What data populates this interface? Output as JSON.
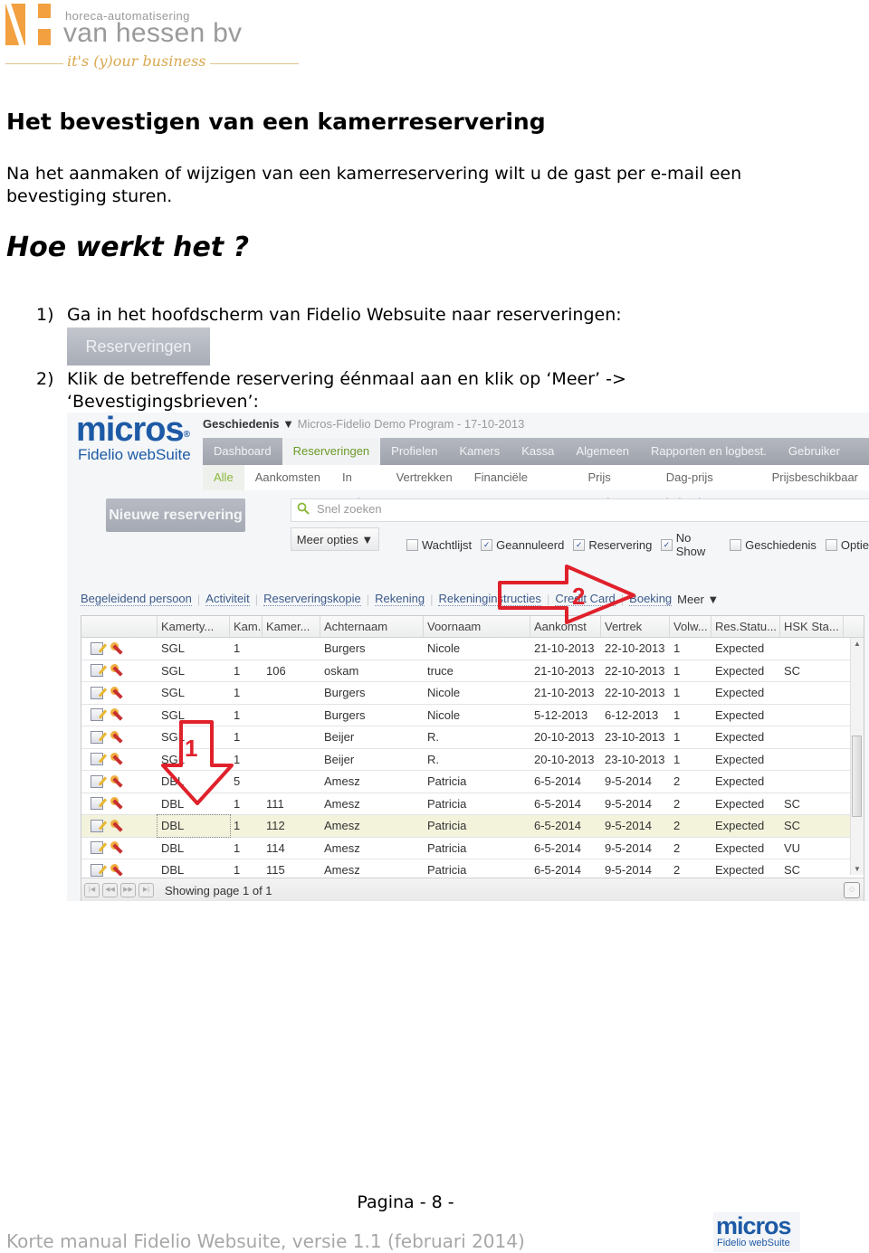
{
  "logo": {
    "tagline": "horeca-automatisering",
    "company": "van hessen bv",
    "slogan": "it's (y)our business"
  },
  "title": "Het bevestigen van een kamerreservering",
  "intro": "Na het aanmaken of wijzigen van een kamerreservering wilt u de gast per e-mail een bevestiging sturen.",
  "howto": "Hoe werkt het ?",
  "steps": [
    {
      "num": "1)",
      "text": "Ga in het hoofdscherm van Fidelio Websuite naar reserveringen:"
    },
    {
      "num": "2)",
      "text": "Klik de betreffende reservering éénmaal aan en klik op ‘Meer’ ->",
      "text2": "‘Bevestigingsbrieven’:"
    }
  ],
  "reserveringen_button": "Reserveringen",
  "app": {
    "logo_main": "micros",
    "logo_reg": "®",
    "logo_sub": "Fidelio webSuite",
    "breadcrumb_bold": "Geschiedenis",
    "breadcrumb_arrow": "▼",
    "breadcrumb_rest": "Micros-Fidelio Demo Program - 17-10-2013",
    "topnav": [
      "Dashboard",
      "Reserveringen",
      "Profielen",
      "Kamers",
      "Kassa",
      "Algemeen",
      "Rapporten en logbest.",
      "Gebruiker"
    ],
    "topnav_active": 1,
    "subnav": [
      "Alle",
      "Aankomsten",
      "In Huis",
      "Vertrekken",
      "Financiële Accounts",
      "Prijs zoeken",
      "Dag-prijs kalender",
      "Prijsbeschikbaar"
    ],
    "subnav_active": 0,
    "new_reservation": "Nieuwe reservering",
    "search_placeholder": "Snel zoeken",
    "more_options": "Meer opties ▼",
    "filters": [
      {
        "label": "Wachtlijst",
        "checked": false
      },
      {
        "label": "Geannuleerd",
        "checked": true
      },
      {
        "label": "Reservering",
        "checked": true
      },
      {
        "label": "No Show",
        "checked": true
      },
      {
        "label": "Geschiedenis",
        "checked": false
      },
      {
        "label": "Optie",
        "checked": false
      }
    ],
    "links": [
      "Begeleidend persoon",
      "Activiteit",
      "Reserveringskopie",
      "Rekening",
      "Rekeninginstructies",
      "Credit Card",
      "Boeking"
    ],
    "more_link": "Meer ▼",
    "columns": [
      "",
      "Kamerty...",
      "Kam...",
      "Kamer...",
      "Achternaam",
      "Voornaam",
      "Aankomst",
      "Vertrek",
      "Volw...",
      "Res.Statu...",
      "HSK Sta..."
    ],
    "rows": [
      [
        "SGL",
        "1",
        "",
        "Burgers",
        "Nicole",
        "21-10-2013",
        "22-10-2013",
        "1",
        "Expected",
        ""
      ],
      [
        "SGL",
        "1",
        "106",
        "oskam",
        "truce",
        "21-10-2013",
        "22-10-2013",
        "1",
        "Expected",
        "SC"
      ],
      [
        "SGL",
        "1",
        "",
        "Burgers",
        "Nicole",
        "21-10-2013",
        "22-10-2013",
        "1",
        "Expected",
        ""
      ],
      [
        "SGL",
        "1",
        "",
        "Burgers",
        "Nicole",
        "5-12-2013",
        "6-12-2013",
        "1",
        "Expected",
        ""
      ],
      [
        "SGL",
        "1",
        "",
        "Beijer",
        "R.",
        "20-10-2013",
        "23-10-2013",
        "1",
        "Expected",
        ""
      ],
      [
        "SGL",
        "1",
        "",
        "Beijer",
        "R.",
        "20-10-2013",
        "23-10-2013",
        "1",
        "Expected",
        ""
      ],
      [
        "DBL",
        "5",
        "",
        "Amesz",
        "Patricia",
        "6-5-2014",
        "9-5-2014",
        "2",
        "Expected",
        ""
      ],
      [
        "DBL",
        "1",
        "111",
        "Amesz",
        "Patricia",
        "6-5-2014",
        "9-5-2014",
        "2",
        "Expected",
        "SC"
      ],
      [
        "DBL",
        "1",
        "112",
        "Amesz",
        "Patricia",
        "6-5-2014",
        "9-5-2014",
        "2",
        "Expected",
        "SC"
      ],
      [
        "DBL",
        "1",
        "114",
        "Amesz",
        "Patricia",
        "6-5-2014",
        "9-5-2014",
        "2",
        "Expected",
        "VU"
      ],
      [
        "DBL",
        "1",
        "115",
        "Amesz",
        "Patricia",
        "6-5-2014",
        "9-5-2014",
        "2",
        "Expected",
        "SC"
      ]
    ],
    "selected_row": 8,
    "pager_text": "Showing page 1 of 1",
    "annotation_1": "1",
    "annotation_2": "2",
    "annotation_color": "#e0212b"
  },
  "page_number": "Pagina - 8 -",
  "footer": "Korte manual Fidelio Websuite, versie 1.1 (februari 2014)",
  "footer_logo_main": "micros",
  "footer_logo_sub": "Fidelio webSuite"
}
